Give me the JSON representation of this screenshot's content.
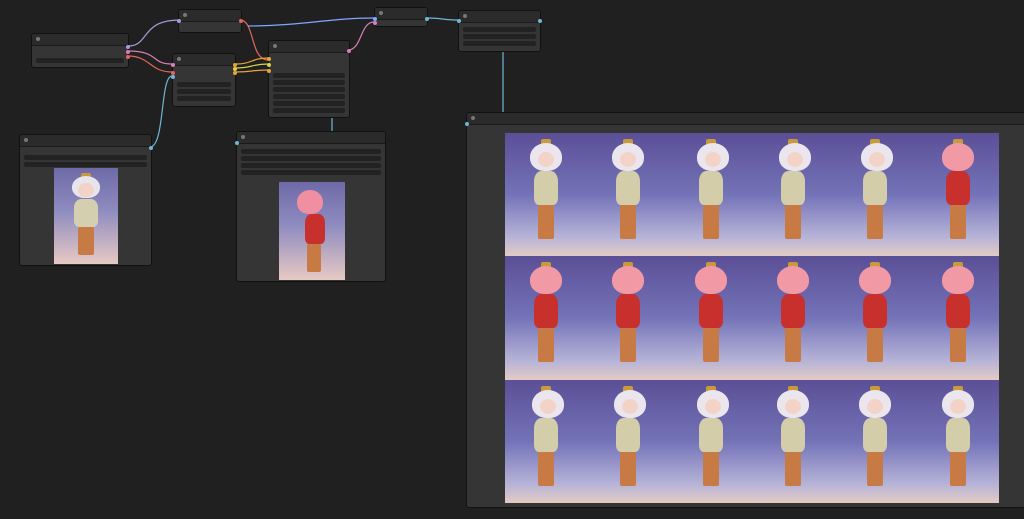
{
  "app": {
    "type": "node-graph-editor",
    "background_color": "#202020",
    "node_color": "#353535",
    "header_color": "#2b2b2b"
  },
  "nodes": [
    {
      "id": "loader",
      "title": "",
      "widgets": 1
    },
    {
      "id": "top-small-1",
      "title": "",
      "widgets": 0
    },
    {
      "id": "middle-combiner",
      "title": "",
      "widgets": 4
    },
    {
      "id": "sampler",
      "title": "",
      "widgets": 6
    },
    {
      "id": "top-small-2",
      "title": "",
      "widgets": 0
    },
    {
      "id": "top-right",
      "title": "",
      "widgets": 3
    },
    {
      "id": "load-image",
      "title": "",
      "widgets": 2
    },
    {
      "id": "preview-single",
      "title": "",
      "widgets": 4
    },
    {
      "id": "preview-grid",
      "title": "",
      "widgets": 0
    }
  ],
  "links": {
    "colors": {
      "pink": "#d67fb5",
      "blue": "#7fa8ff",
      "red": "#e3665a",
      "orange": "#e7a43a",
      "yellow": "#d9d34a",
      "cyan": "#6fb6d6",
      "lavender": "#a79ad8"
    }
  },
  "images": {
    "input": {
      "description_icon": "character-reference-image"
    },
    "single": {
      "description_icon": "character-side-view-image"
    },
    "grid": {
      "rows": 3,
      "cols": 6,
      "views": [
        "front-left",
        "front",
        "three-quarter",
        "side",
        "side-back",
        "back-three-quarter",
        "back-left",
        "back",
        "back",
        "back",
        "back-right",
        "back-right",
        "side-back",
        "side",
        "three-quarter",
        "front-right",
        "front",
        "front-left"
      ]
    }
  }
}
